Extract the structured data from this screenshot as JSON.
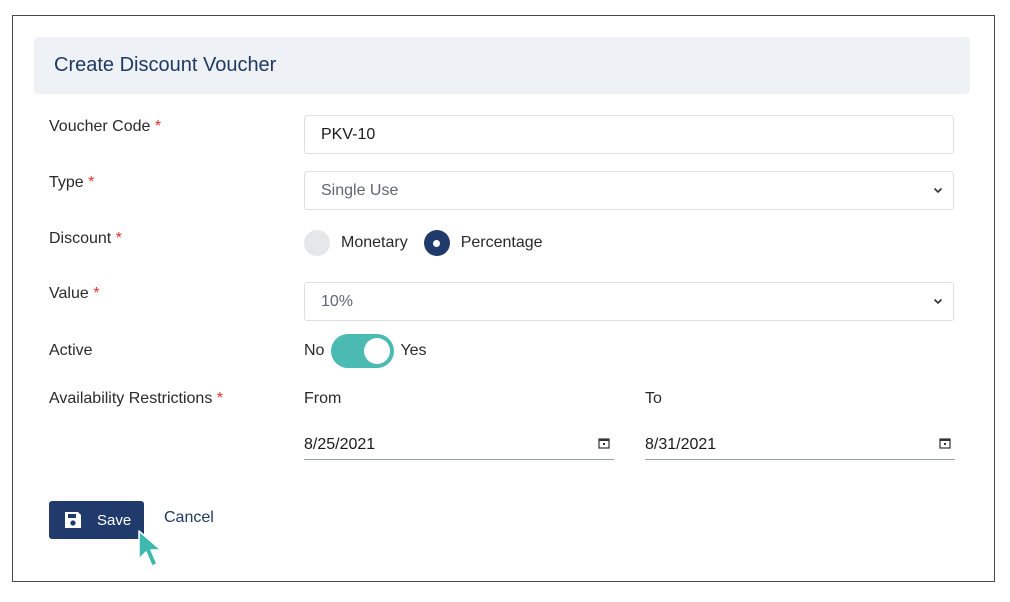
{
  "header": {
    "title": "Create Discount Voucher"
  },
  "form": {
    "voucher_code": {
      "label": "Voucher Code",
      "required_mark": "*",
      "value": "PKV-10"
    },
    "type": {
      "label": "Type",
      "required_mark": "*",
      "value": "Single Use",
      "icon": "chevron-down-icon"
    },
    "discount": {
      "label": "Discount",
      "required_mark": "*",
      "options": [
        {
          "label": "Monetary",
          "selected": false
        },
        {
          "label": "Percentage",
          "selected": true
        }
      ]
    },
    "value": {
      "label": "Value",
      "required_mark": "*",
      "value": "10%",
      "icon": "chevron-down-icon"
    },
    "active": {
      "label": "Active",
      "off_label": "No",
      "on_label": "Yes",
      "state": true
    },
    "availability": {
      "label": "Availability Restrictions",
      "required_mark": "*",
      "from_label": "From",
      "from_value": "8/25/2021",
      "to_label": "To",
      "to_value": "8/31/2021",
      "icon": "calendar-icon"
    }
  },
  "actions": {
    "save_label": "Save",
    "save_icon": "save-icon",
    "cancel_label": "Cancel"
  },
  "colors": {
    "primary": "#1f3a6b",
    "toggle_on": "#4bbab2",
    "required": "#e0322a",
    "header_bg": "#eef1f5",
    "cursor": "#3fb8ae"
  }
}
